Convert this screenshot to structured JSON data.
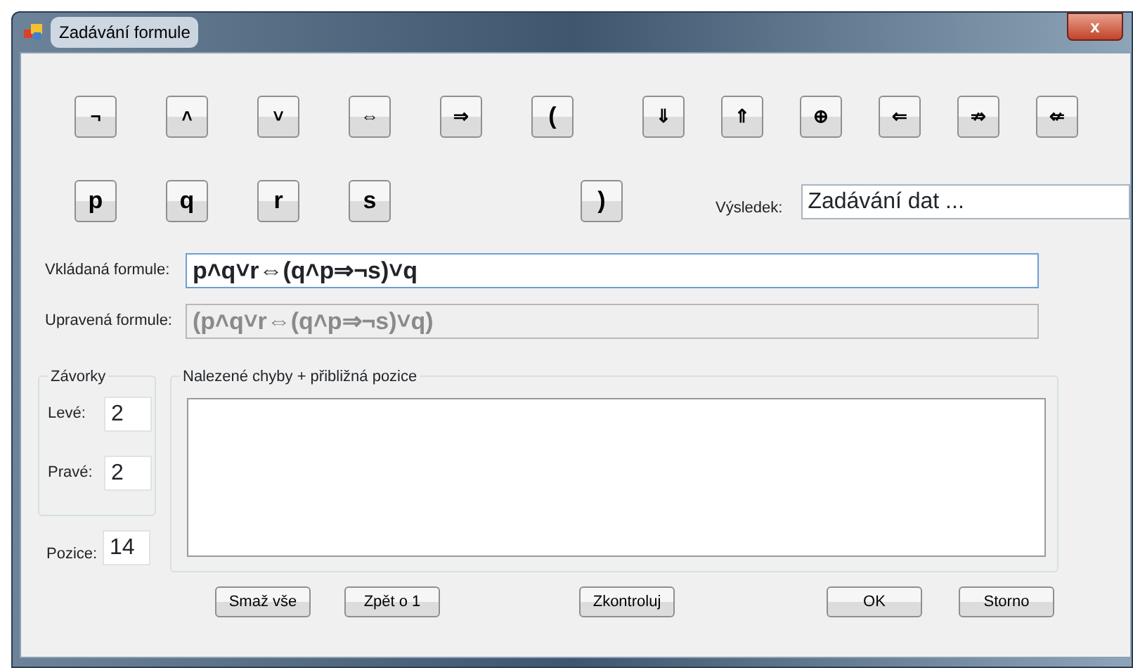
{
  "window": {
    "title": "Zadávání formule",
    "close": "x"
  },
  "symbol_buttons": [
    {
      "label": "¬"
    },
    {
      "label": "˄"
    },
    {
      "label": "˅"
    },
    {
      "label": "⇔"
    },
    {
      "label": "⇒"
    },
    {
      "label": "("
    },
    {
      "label": "⇓"
    },
    {
      "label": "⇑"
    },
    {
      "label": "⊕"
    },
    {
      "label": "⇐"
    },
    {
      "label": "⇏"
    },
    {
      "label": "⇍"
    }
  ],
  "variable_buttons": [
    {
      "label": "p"
    },
    {
      "label": "q"
    },
    {
      "label": "r"
    },
    {
      "label": "s"
    }
  ],
  "close_paren_button": {
    "label": ")"
  },
  "result": {
    "label": "Výsledek:",
    "value": "Zadávání dat ..."
  },
  "formulas": [
    {
      "label": "Vkládaná formule:",
      "value": "p˄q˅r⇔(q˄p⇒¬s)˅q",
      "disabled": false
    },
    {
      "label": "Upravená formule:",
      "value": "(p˄q˅r⇔(q˄p⇒¬s)˅q)",
      "disabled": true
    }
  ],
  "brackets": {
    "title": "Závorky",
    "left": {
      "label": "Levé:",
      "value": "2"
    },
    "right": {
      "label": "Pravé:",
      "value": "2"
    }
  },
  "position": {
    "label": "Pozice:",
    "value": "14"
  },
  "errors": {
    "title": "Nalezené chyby + přibližná pozice"
  },
  "buttons": [
    {
      "label": "Smaž vše",
      "kind": "left"
    },
    {
      "label": "Zpět o 1",
      "kind": "left"
    },
    {
      "label": "Zkontroluj",
      "kind": "middle"
    },
    {
      "label": "OK",
      "kind": "right"
    },
    {
      "label": "Storno",
      "kind": "right"
    }
  ]
}
